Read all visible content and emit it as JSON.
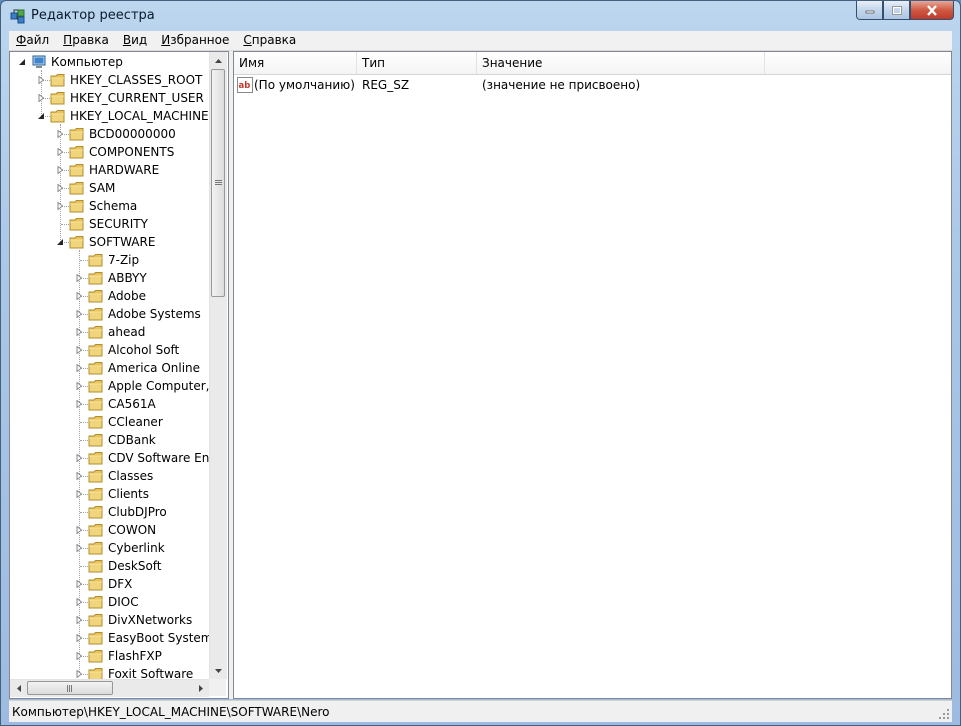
{
  "window": {
    "title": "Редактор реестра"
  },
  "menu": [
    "Файл",
    "Правка",
    "Вид",
    "Избранное",
    "Справка"
  ],
  "icons": {
    "app": "registry-editor-icon",
    "computer": "computer-icon",
    "folder": "folder-icon",
    "string_value": "string-value-icon"
  },
  "colors": {
    "folder": "#e8c45a",
    "title_bar": "#a9c6e6"
  },
  "tree": [
    {
      "label": "Компьютер",
      "level": 0,
      "state": "expanded",
      "icon": "computer"
    },
    {
      "label": "HKEY_CLASSES_ROOT",
      "level": 1,
      "state": "collapsed"
    },
    {
      "label": "HKEY_CURRENT_USER",
      "level": 1,
      "state": "collapsed"
    },
    {
      "label": "HKEY_LOCAL_MACHINE",
      "level": 1,
      "state": "expanded"
    },
    {
      "label": "BCD00000000",
      "level": 2,
      "state": "collapsed"
    },
    {
      "label": "COMPONENTS",
      "level": 2,
      "state": "collapsed"
    },
    {
      "label": "HARDWARE",
      "level": 2,
      "state": "collapsed"
    },
    {
      "label": "SAM",
      "level": 2,
      "state": "collapsed"
    },
    {
      "label": "Schema",
      "level": 2,
      "state": "collapsed"
    },
    {
      "label": "SECURITY",
      "level": 2,
      "state": "leaf"
    },
    {
      "label": "SOFTWARE",
      "level": 2,
      "state": "expanded"
    },
    {
      "label": "7-Zip",
      "level": 3,
      "state": "leaf"
    },
    {
      "label": "ABBYY",
      "level": 3,
      "state": "collapsed"
    },
    {
      "label": "Adobe",
      "level": 3,
      "state": "collapsed"
    },
    {
      "label": "Adobe Systems",
      "level": 3,
      "state": "collapsed"
    },
    {
      "label": "ahead",
      "level": 3,
      "state": "collapsed"
    },
    {
      "label": "Alcohol Soft",
      "level": 3,
      "state": "collapsed"
    },
    {
      "label": "America Online",
      "level": 3,
      "state": "collapsed"
    },
    {
      "label": "Apple Computer, I",
      "level": 3,
      "state": "collapsed"
    },
    {
      "label": "CA561A",
      "level": 3,
      "state": "collapsed"
    },
    {
      "label": "CCleaner",
      "level": 3,
      "state": "leaf"
    },
    {
      "label": "CDBank",
      "level": 3,
      "state": "leaf"
    },
    {
      "label": "CDV Software Ente",
      "level": 3,
      "state": "collapsed"
    },
    {
      "label": "Classes",
      "level": 3,
      "state": "collapsed"
    },
    {
      "label": "Clients",
      "level": 3,
      "state": "collapsed"
    },
    {
      "label": "ClubDJPro",
      "level": 3,
      "state": "leaf"
    },
    {
      "label": "COWON",
      "level": 3,
      "state": "collapsed"
    },
    {
      "label": "Cyberlink",
      "level": 3,
      "state": "collapsed"
    },
    {
      "label": "DeskSoft",
      "level": 3,
      "state": "leaf"
    },
    {
      "label": "DFX",
      "level": 3,
      "state": "collapsed"
    },
    {
      "label": "DIOC",
      "level": 3,
      "state": "collapsed"
    },
    {
      "label": "DivXNetworks",
      "level": 3,
      "state": "collapsed"
    },
    {
      "label": "EasyBoot Systems",
      "level": 3,
      "state": "collapsed"
    },
    {
      "label": "FlashFXP",
      "level": 3,
      "state": "collapsed"
    },
    {
      "label": "Foxit Software",
      "level": 3,
      "state": "collapsed"
    }
  ],
  "list": {
    "columns": [
      "Имя",
      "Тип",
      "Значение"
    ],
    "rows": [
      {
        "name": "(По умолчанию)",
        "type": "REG_SZ",
        "value": "(значение не присвоено)"
      }
    ]
  },
  "status": {
    "path": "Компьютер\\HKEY_LOCAL_MACHINE\\SOFTWARE\\Nero"
  }
}
